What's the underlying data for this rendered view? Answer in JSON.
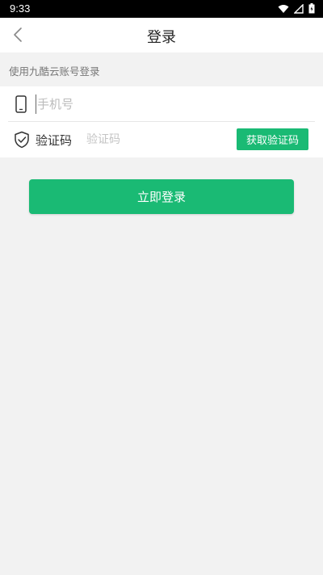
{
  "status_bar": {
    "time": "9:33",
    "icons": [
      "wifi-icon",
      "signal-icon",
      "battery-icon"
    ]
  },
  "app_bar": {
    "title": "登录",
    "back_icon": "chevron-left-icon"
  },
  "hint": "使用九酷云账号登录",
  "form": {
    "phone": {
      "icon": "phone-icon",
      "value": "",
      "placeholder": "手机号"
    },
    "code": {
      "icon": "shield-check-icon",
      "label": "验证码",
      "value": "",
      "placeholder": "验证码",
      "get_code_label": "获取验证码"
    }
  },
  "login_button": "立即登录",
  "colors": {
    "accent": "#1aba74",
    "background": "#f2f2f2",
    "surface": "#ffffff"
  }
}
